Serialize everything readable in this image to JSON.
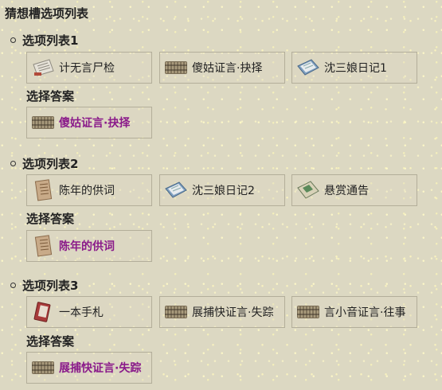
{
  "title": "猜想槽选项列表",
  "answer_label": "选择答案",
  "groups": [
    {
      "title": "选项列表1",
      "options": [
        {
          "label": "计无言尸检",
          "icon": "paper-report-icon"
        },
        {
          "label": "傻姑证言·抉择",
          "icon": "bamboo-scroll-icon"
        },
        {
          "label": "沈三娘日记1",
          "icon": "diary-book-icon"
        }
      ],
      "answer": {
        "label": "傻姑证言·抉择",
        "icon": "bamboo-scroll-icon"
      }
    },
    {
      "title": "选项列表2",
      "options": [
        {
          "label": "陈年的供词",
          "icon": "old-confession-icon"
        },
        {
          "label": "沈三娘日记2",
          "icon": "diary-book-icon"
        },
        {
          "label": "悬赏通告",
          "icon": "bounty-notice-icon"
        }
      ],
      "answer": {
        "label": "陈年的供词",
        "icon": "old-confession-icon"
      }
    },
    {
      "title": "选项列表3",
      "options": [
        {
          "label": "一本手札",
          "icon": "red-notebook-icon"
        },
        {
          "label": "展捕快证言·失踪",
          "icon": "bamboo-scroll-icon"
        },
        {
          "label": "言小音证言·往事",
          "icon": "bamboo-scroll-icon"
        }
      ],
      "answer": {
        "label": "展捕快证言·失踪",
        "icon": "bamboo-scroll-icon"
      }
    }
  ]
}
